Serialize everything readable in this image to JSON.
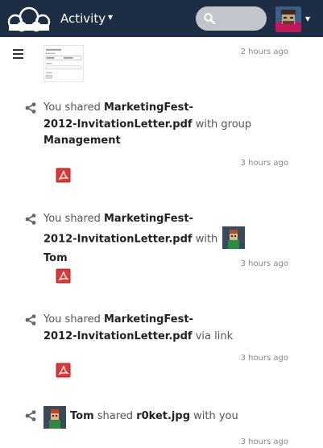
{
  "header": {
    "app_name": "Activity",
    "app_caret": "▾",
    "user_caret": "▾",
    "search_placeholder": "",
    "background_color": "#1d2d44"
  },
  "first_item": {
    "time": "2 hours ago"
  },
  "activities": [
    {
      "prefix": "You shared",
      "file_part1": "MarketingFest-",
      "file_part2": "2012-InvitationLetter.pdf",
      "suffix": "with group",
      "target": "Management",
      "time": "3 hours ago"
    },
    {
      "prefix": "You shared",
      "file_part1": "MarketingFest-",
      "file_part2": "2012-InvitationLetter.pdf",
      "suffix": "with",
      "target": "Tom",
      "time": "3 hours ago"
    },
    {
      "prefix": "You shared",
      "file_part1": "MarketingFest-",
      "file_part2": "2012-InvitationLetter.pdf",
      "suffix": "via link",
      "time": "3 hours ago"
    },
    {
      "user": "Tom",
      "verb": "shared",
      "file": "r0ket.jpg",
      "suffix": "with you",
      "time": "3 hours ago"
    }
  ],
  "colors": {
    "pdf_red": "#d83a3a",
    "link_bold": "#222222",
    "muted": "#888888"
  }
}
